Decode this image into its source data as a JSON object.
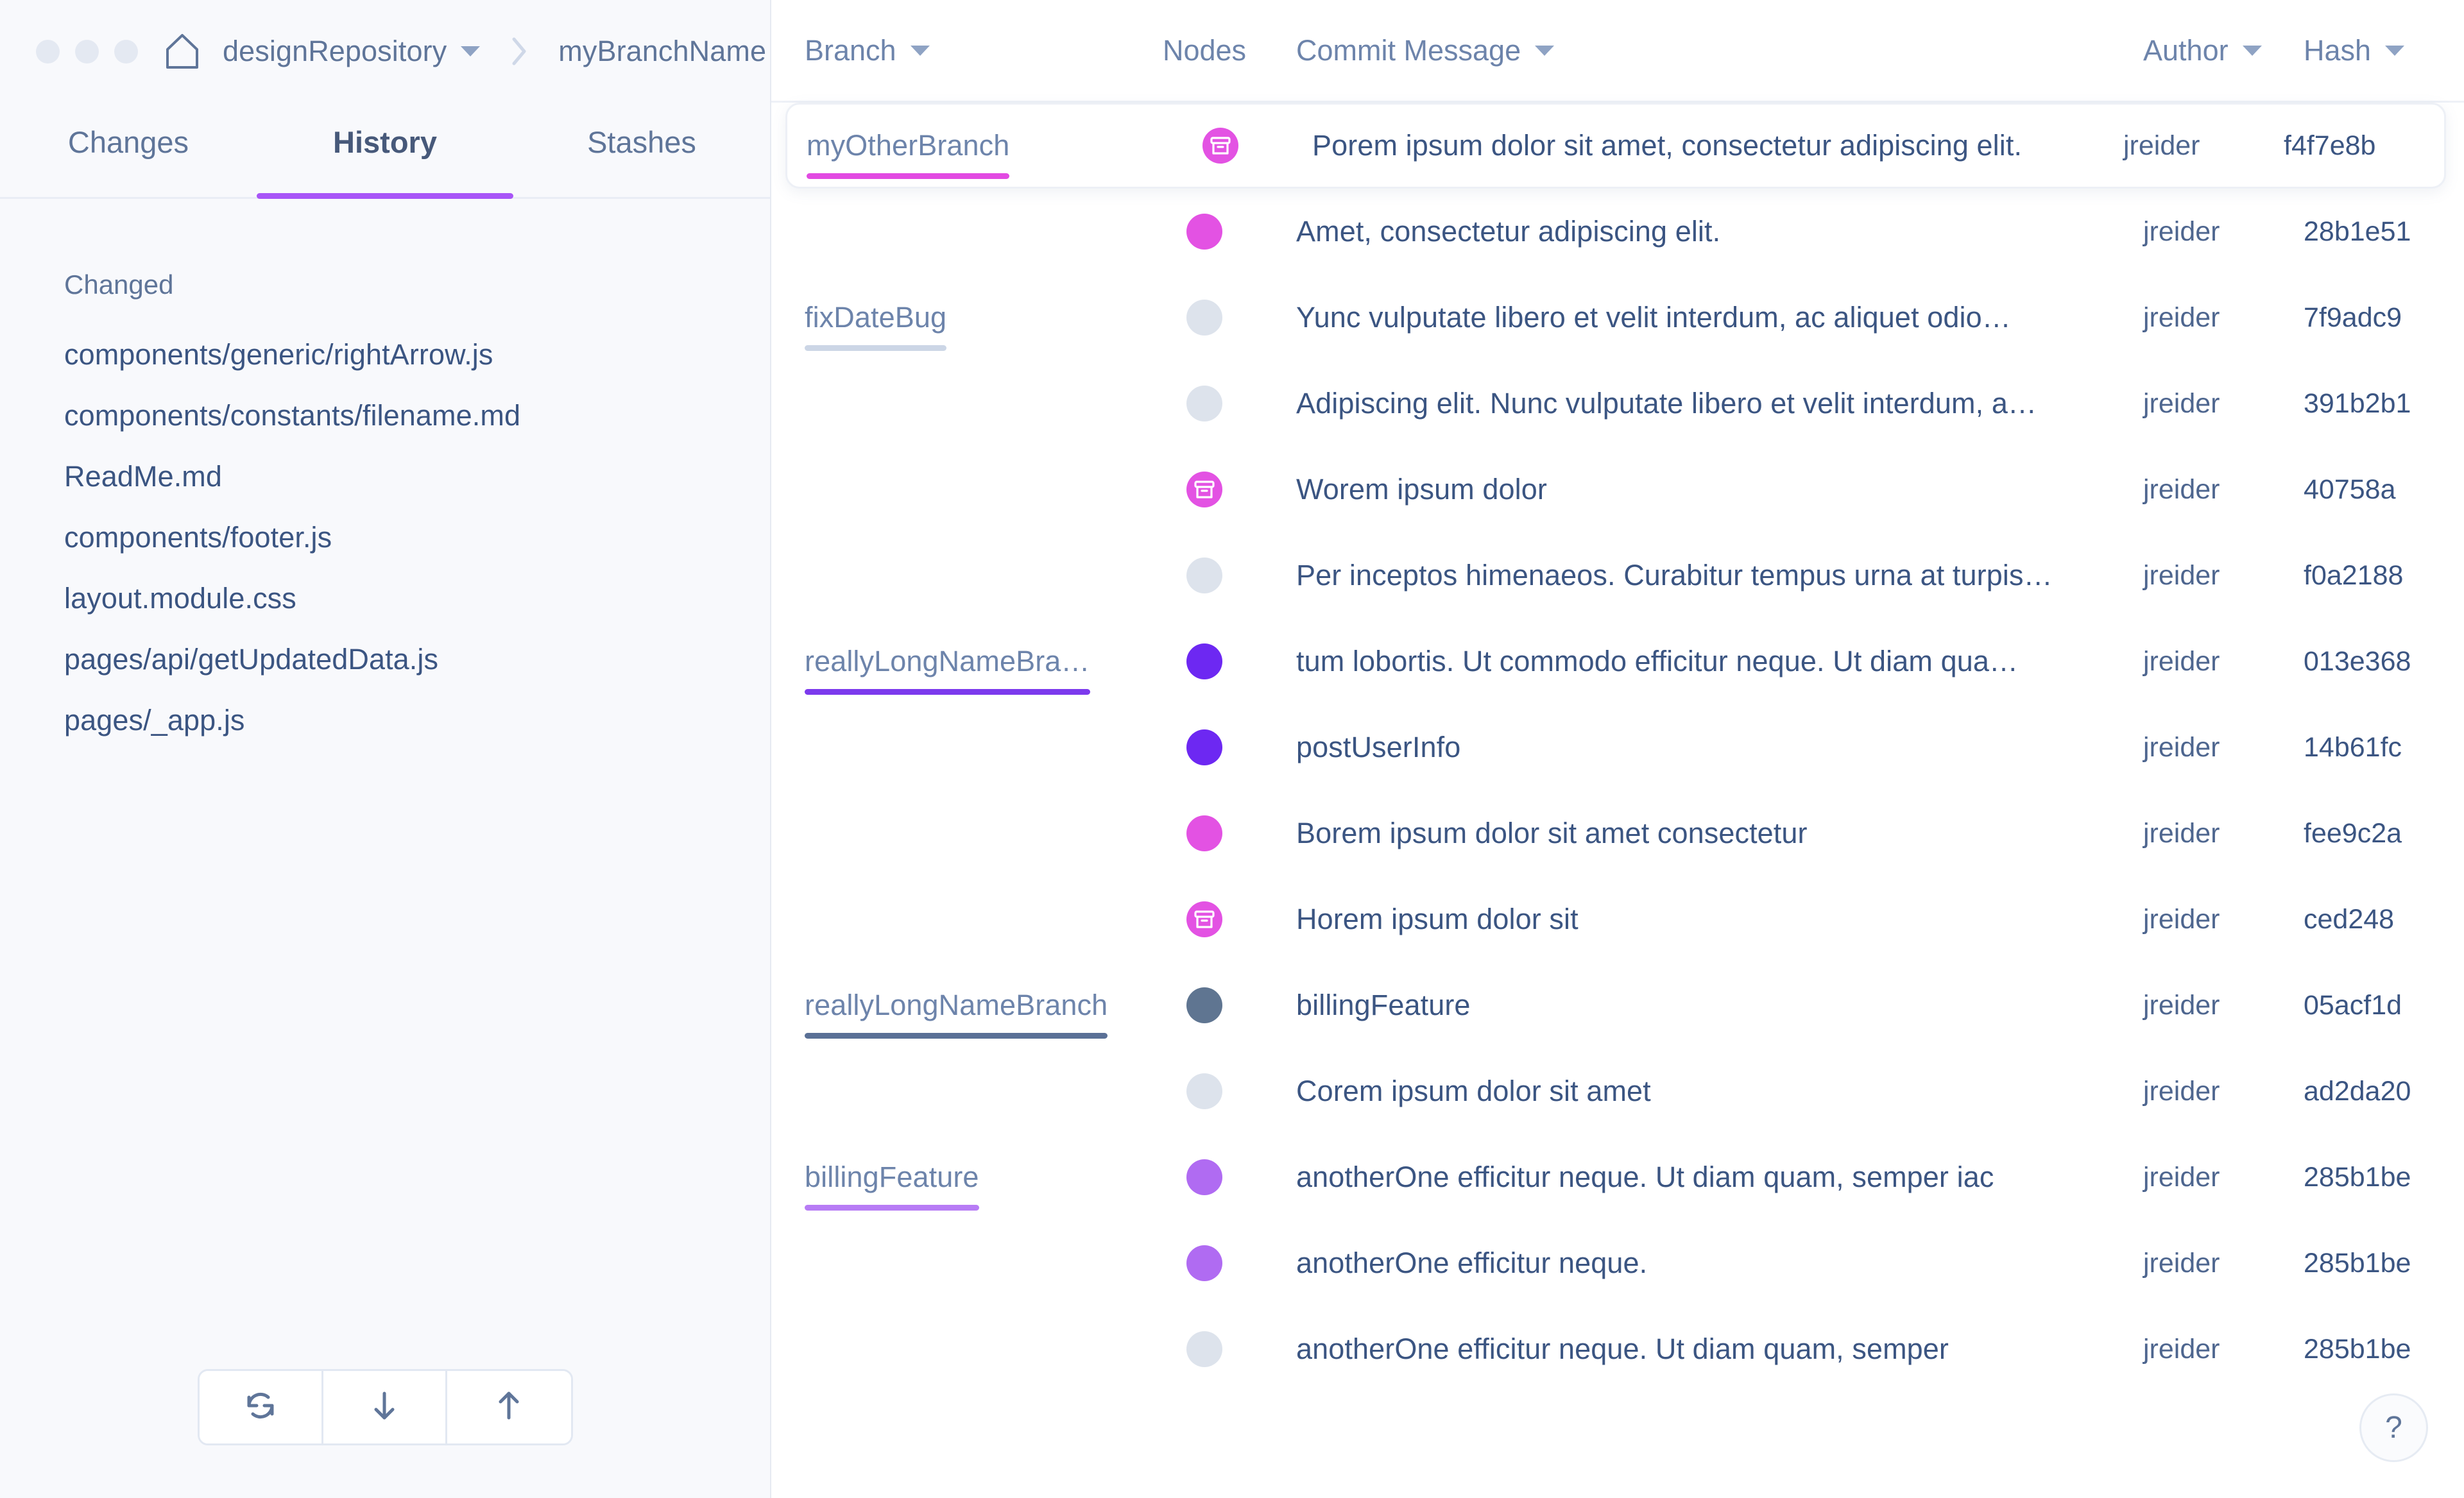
{
  "window": {
    "traffic_lights": [
      "close",
      "minimize",
      "maximize"
    ],
    "home_icon": "home-icon"
  },
  "breadcrumb": {
    "repository": "designRepository",
    "branch": "myBranchName",
    "separator": "›"
  },
  "tabs": [
    {
      "label": "Changes",
      "active": false
    },
    {
      "label": "History",
      "active": true
    },
    {
      "label": "Stashes",
      "active": false
    }
  ],
  "sidebar": {
    "section_label": "Changed",
    "files": [
      "components/generic/rightArrow.js",
      "components/constants/filename.md",
      "ReadMe.md",
      "components/footer.js",
      "layout.module.css",
      "pages/api/getUpdatedData.js",
      "pages/_app.js"
    ],
    "footer_buttons": [
      {
        "name": "sync-icon",
        "glyph": "sync"
      },
      {
        "name": "arrow-down-icon",
        "glyph": "down"
      },
      {
        "name": "arrow-up-icon",
        "glyph": "up"
      }
    ]
  },
  "table": {
    "columns": [
      {
        "label": "Branch",
        "sortable": true
      },
      {
        "label": "Nodes",
        "sortable": false
      },
      {
        "label": "Commit Message",
        "sortable": true
      },
      {
        "label": "Author",
        "sortable": true
      },
      {
        "label": "Hash",
        "sortable": true
      }
    ],
    "rows": [
      {
        "branch": "myOtherBranch",
        "branch_underline": "#e24ae2",
        "node_color": "#e352e3",
        "node_type": "merge",
        "message": "Porem ipsum dolor sit amet, consectetur adipiscing elit.",
        "author": "jreider",
        "hash": "f4f7e8b",
        "selected": true
      },
      {
        "branch": "",
        "branch_underline": "",
        "node_color": "#e352e3",
        "node_type": "dot",
        "message": "Amet, consectetur adipiscing elit.",
        "author": "jreider",
        "hash": "28b1e51",
        "selected": false
      },
      {
        "branch": "fixDateBug",
        "branch_underline": "#ccd6e6",
        "node_color": "#dde3ec",
        "node_type": "dot",
        "message": "Yunc vulputate libero et velit interdum, ac aliquet odio…",
        "author": "jreider",
        "hash": "7f9adc9",
        "selected": false
      },
      {
        "branch": "",
        "branch_underline": "",
        "node_color": "#dde3ec",
        "node_type": "dot",
        "message": "Adipiscing elit. Nunc vulputate libero et velit interdum, a…",
        "author": "jreider",
        "hash": "391b2b1",
        "selected": false
      },
      {
        "branch": "",
        "branch_underline": "",
        "node_color": "#e352e3",
        "node_type": "merge",
        "message": "Worem ipsum dolor",
        "author": "jreider",
        "hash": "40758a",
        "selected": false
      },
      {
        "branch": "",
        "branch_underline": "",
        "node_color": "#dde3ec",
        "node_type": "dot",
        "message": "Per inceptos himenaeos. Curabitur tempus urna at turpis…",
        "author": "jreider",
        "hash": "f0a2188",
        "selected": false
      },
      {
        "branch": "reallyLongNameBra…",
        "branch_underline": "#7c3aed",
        "node_color": "#6d28f2",
        "node_type": "dot",
        "message": "tum lobortis. Ut commodo efficitur neque. Ut diam qua…",
        "author": "jreider",
        "hash": "013e368",
        "selected": false
      },
      {
        "branch": "",
        "branch_underline": "",
        "node_color": "#6d28f2",
        "node_type": "dot",
        "message": "postUserInfo",
        "author": "jreider",
        "hash": "14b61fc",
        "selected": false
      },
      {
        "branch": "",
        "branch_underline": "",
        "node_color": "#e352e3",
        "node_type": "dot",
        "message": "Borem ipsum dolor sit amet consectetur",
        "author": "jreider",
        "hash": "fee9c2a",
        "selected": false
      },
      {
        "branch": "",
        "branch_underline": "",
        "node_color": "#e352e3",
        "node_type": "merge",
        "message": "Horem ipsum dolor sit",
        "author": "jreider",
        "hash": "ced248",
        "selected": false
      },
      {
        "branch": "reallyLongNameBranch",
        "branch_underline": "#5a7096",
        "node_color": "#5f7591",
        "node_type": "dot",
        "message": "billingFeature",
        "author": "jreider",
        "hash": "05acf1d",
        "selected": false
      },
      {
        "branch": "",
        "branch_underline": "",
        "node_color": "#dde3ec",
        "node_type": "dot",
        "message": "Corem ipsum dolor sit amet",
        "author": "jreider",
        "hash": "ad2da20",
        "selected": false
      },
      {
        "branch": "billingFeature",
        "branch_underline": "#b77cf5",
        "node_color": "#b06bf2",
        "node_type": "dot",
        "message": "anotherOne efficitur neque. Ut diam quam, semper iac",
        "author": "jreider",
        "hash": "285b1be",
        "selected": false
      },
      {
        "branch": "",
        "branch_underline": "",
        "node_color": "#b06bf2",
        "node_type": "dot",
        "message": "anotherOne efficitur neque.",
        "author": "jreider",
        "hash": "285b1be",
        "selected": false
      },
      {
        "branch": "",
        "branch_underline": "",
        "node_color": "#dde3ec",
        "node_type": "dot",
        "message": "anotherOne efficitur neque. Ut diam quam, semper",
        "author": "jreider",
        "hash": "285b1be",
        "selected": false
      }
    ]
  },
  "help": {
    "label": "?"
  },
  "colors": {
    "accent_purple": "#a855f7",
    "text_primary": "#3b5582",
    "text_muted": "#6d84ab",
    "sidebar_bg": "#f8f9fc"
  }
}
